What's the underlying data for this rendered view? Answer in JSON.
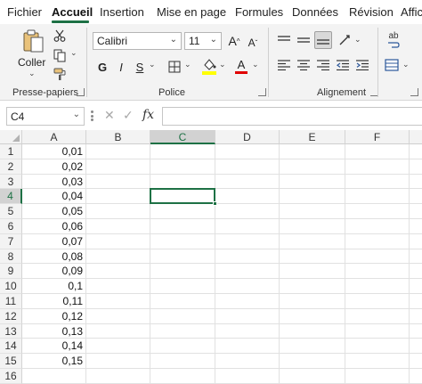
{
  "tabs": [
    {
      "label": "Fichier",
      "active": false
    },
    {
      "label": "Accueil",
      "active": true
    },
    {
      "label": "Insertion",
      "active": false
    },
    {
      "label": "Mise en page",
      "active": false
    },
    {
      "label": "Formules",
      "active": false
    },
    {
      "label": "Données",
      "active": false
    },
    {
      "label": "Révision",
      "active": false
    },
    {
      "label": "Affic",
      "active": false
    }
  ],
  "ribbon": {
    "clipboard": {
      "paste_label": "Coller",
      "group_label": "Presse-papiers"
    },
    "font": {
      "name": "Calibri",
      "size": "11",
      "bold": "G",
      "italic": "I",
      "underline": "S",
      "grow": "A",
      "shrink": "A",
      "color_letter": "A",
      "group_label": "Police"
    },
    "alignment": {
      "group_label": "Alignement",
      "wrap_icon_text": "ab"
    },
    "colors": {
      "accent": "#1e7145",
      "highlight": "#ffff00",
      "font_color": "#e00000"
    }
  },
  "formula_bar": {
    "name_box": "C4",
    "fx": "fx",
    "content": ""
  },
  "grid": {
    "columns": [
      "A",
      "B",
      "C",
      "D",
      "E",
      "F"
    ],
    "selected_column": "C",
    "selected_row": "4",
    "rows": [
      {
        "num": "1",
        "a": "0,01"
      },
      {
        "num": "2",
        "a": "0,02"
      },
      {
        "num": "3",
        "a": "0,03"
      },
      {
        "num": "4",
        "a": "0,04"
      },
      {
        "num": "5",
        "a": "0,05"
      },
      {
        "num": "6",
        "a": "0,06"
      },
      {
        "num": "7",
        "a": "0,07"
      },
      {
        "num": "8",
        "a": "0,08"
      },
      {
        "num": "9",
        "a": "0,09"
      },
      {
        "num": "10",
        "a": "0,1"
      },
      {
        "num": "11",
        "a": "0,11"
      },
      {
        "num": "12",
        "a": "0,12"
      },
      {
        "num": "13",
        "a": "0,13"
      },
      {
        "num": "14",
        "a": "0,14"
      },
      {
        "num": "15",
        "a": "0,15"
      },
      {
        "num": "16",
        "a": ""
      }
    ]
  }
}
